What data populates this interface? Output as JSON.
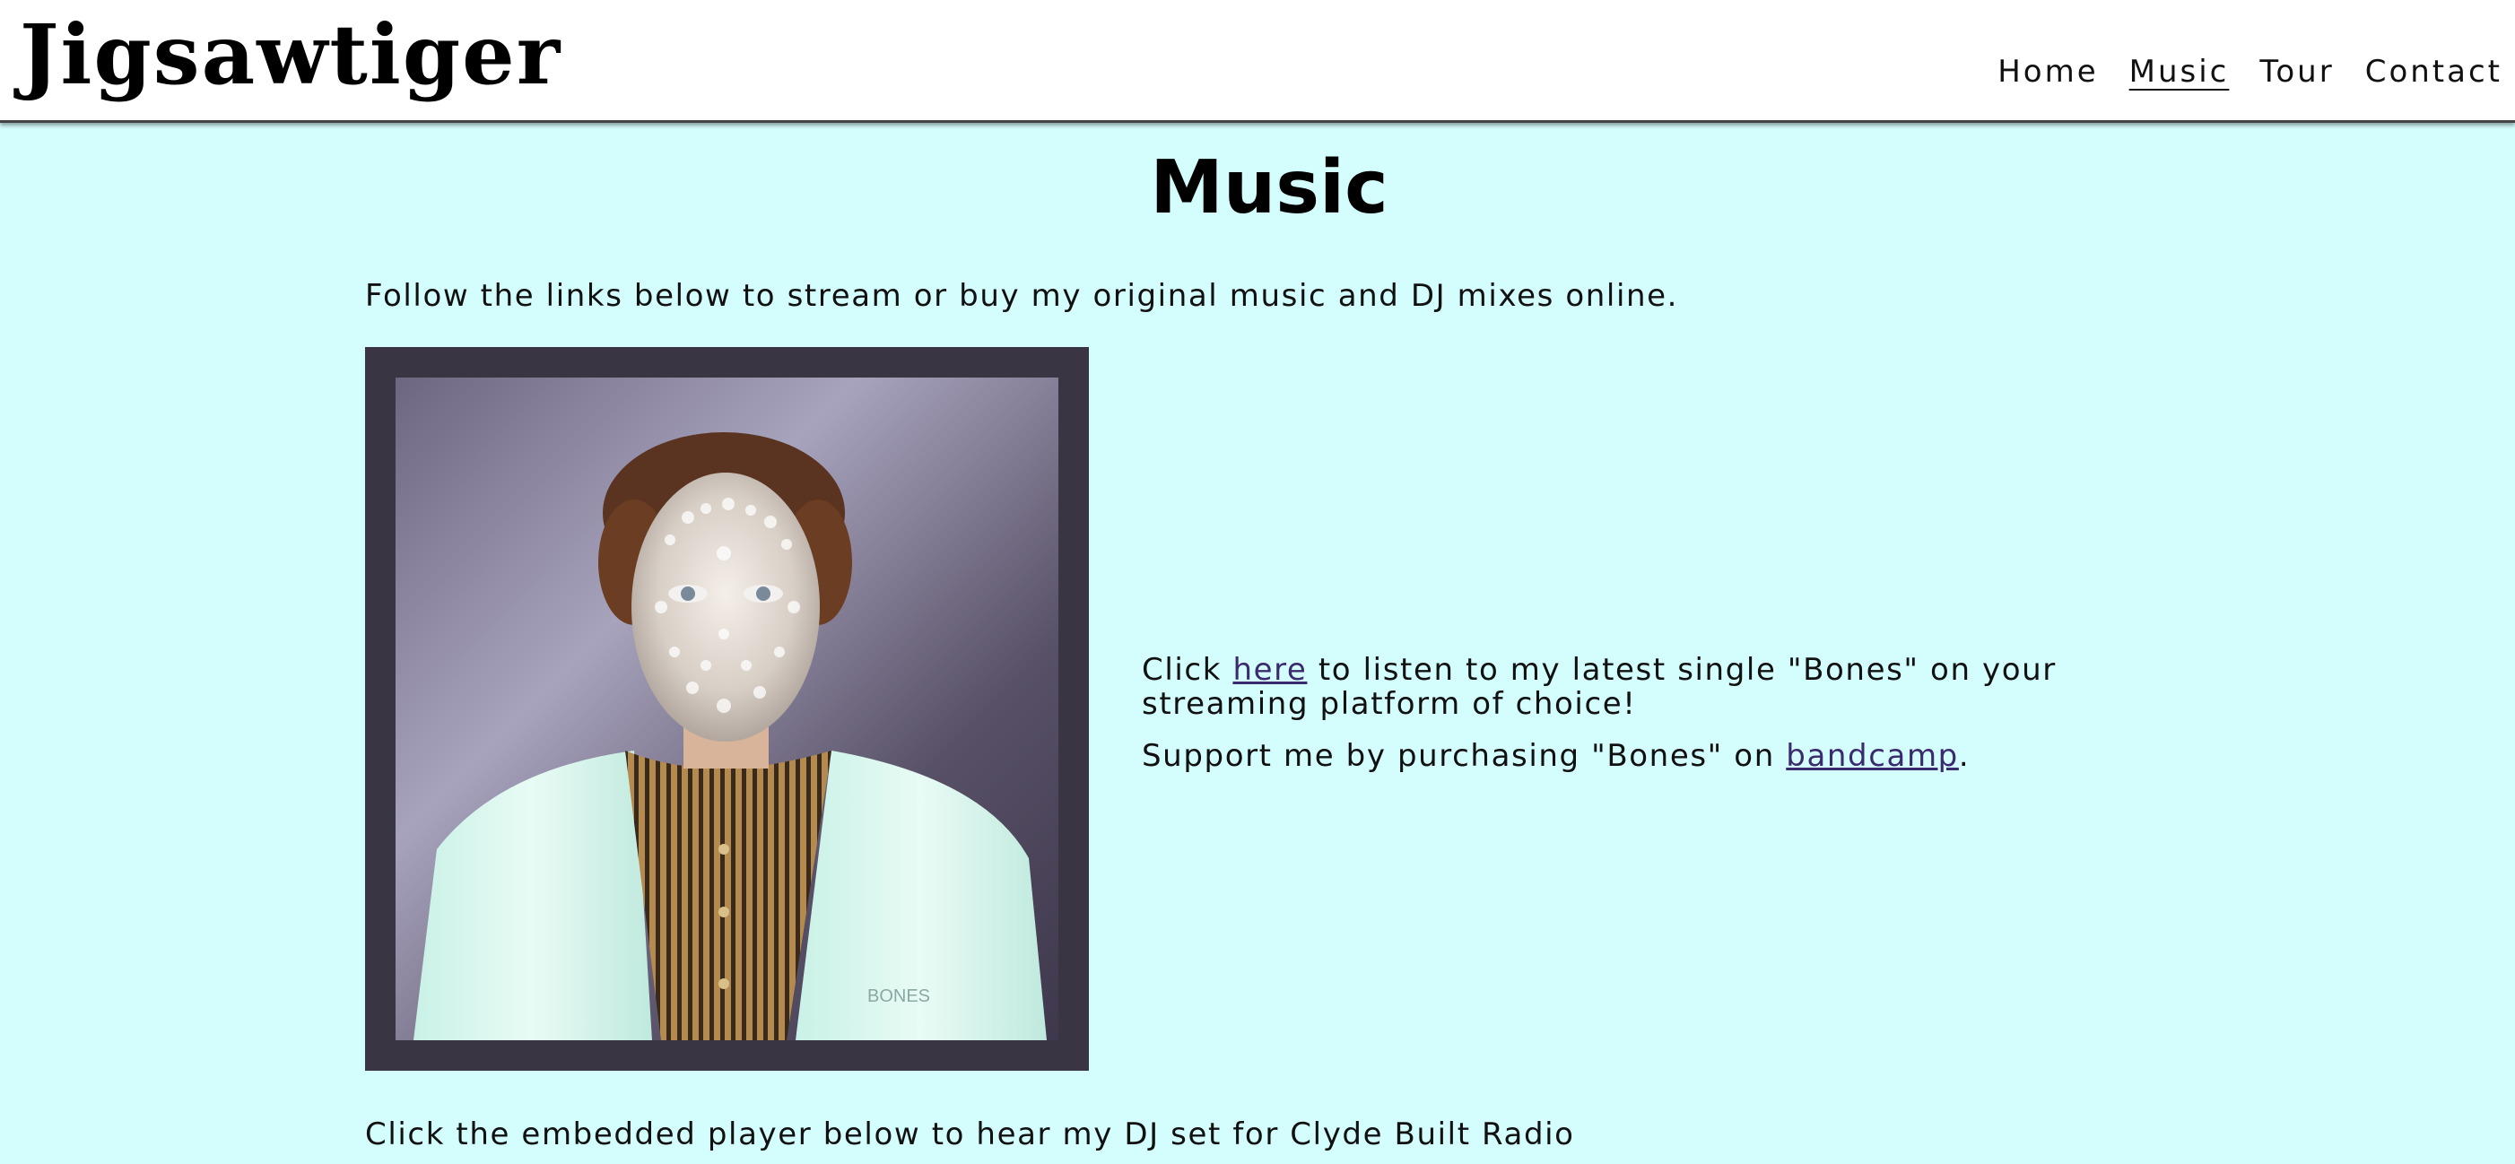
{
  "site": {
    "title": "Jigsawtiger"
  },
  "nav": {
    "items": [
      {
        "label": "Home"
      },
      {
        "label": "Music"
      },
      {
        "label": "Tour"
      },
      {
        "label": "Contact"
      }
    ],
    "active": "Music"
  },
  "page": {
    "heading": "Music",
    "intro": "Follow the links below to stream or buy my original music and DJ mixes online.",
    "single": {
      "cover_text": "BONES",
      "stream_prefix": "Click ",
      "stream_link": "here",
      "stream_suffix": " to listen to my latest single \"Bones\" on your streaming platform of choice!",
      "buy_prefix": "Support me by purchasing \"Bones\" on ",
      "buy_link": "bandcamp",
      "buy_suffix": "."
    },
    "embed_note": "Click the embedded player below to hear my DJ set for Clyde Built Radio"
  },
  "colors": {
    "background": "#d4fdfd",
    "header": "#ffffff",
    "link": "#3a2a6e",
    "cover_frame": "#3a3542"
  }
}
